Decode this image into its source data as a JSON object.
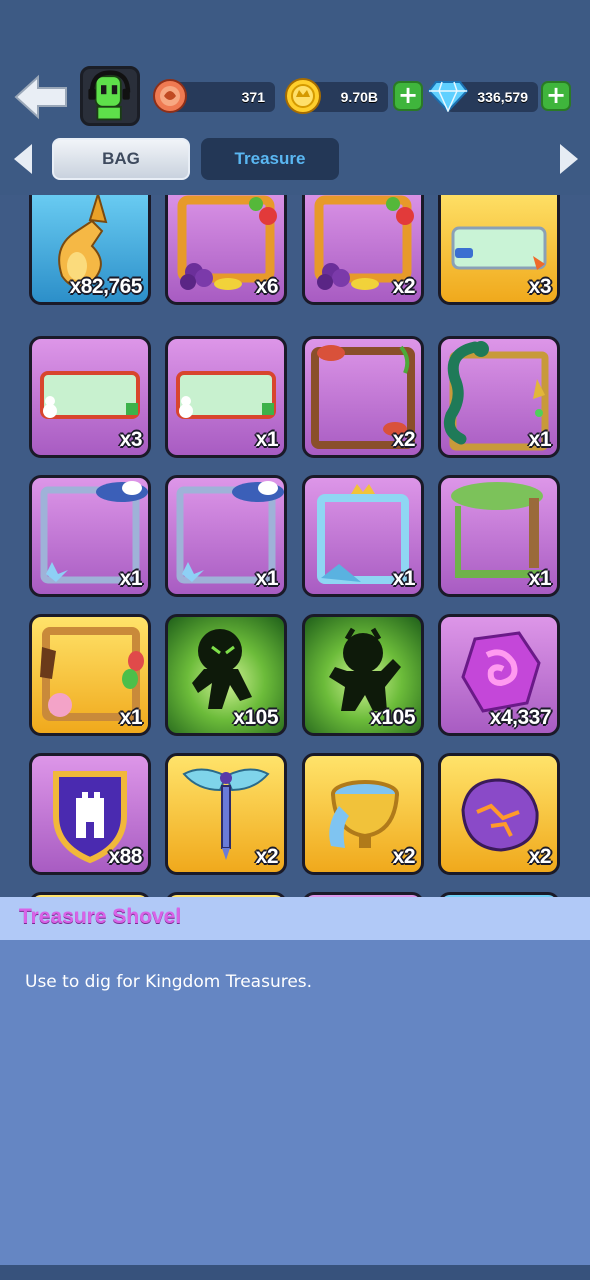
{
  "header": {
    "resources": [
      {
        "name": "energy-token",
        "value": "371"
      },
      {
        "name": "gold-coin",
        "value": "9.70B"
      },
      {
        "name": "diamond",
        "value": "336,579"
      }
    ]
  },
  "tabs": {
    "bag": "BAG",
    "treasure": "Treasure"
  },
  "items": [
    {
      "icon": "potion-bottle-icon",
      "bg": "blue",
      "qty": "x82,765"
    },
    {
      "icon": "fruit-frame-icon",
      "bg": "purple",
      "qty": "x6"
    },
    {
      "icon": "fruit-frame-icon",
      "bg": "purple",
      "qty": "x2"
    },
    {
      "icon": "vip-nameplate-icon",
      "bg": "gold",
      "qty": "x3"
    },
    {
      "icon": "snowman-nameplate-icon",
      "bg": "purple",
      "qty": "x3"
    },
    {
      "icon": "snowman-nameplate-icon",
      "bg": "purple",
      "qty": "x1"
    },
    {
      "icon": "mushroom-frame-icon",
      "bg": "purple",
      "qty": "x2"
    },
    {
      "icon": "serpent-frame-icon",
      "bg": "purple",
      "qty": "x1"
    },
    {
      "icon": "winter-hat-frame-icon",
      "bg": "purple",
      "qty": "x1"
    },
    {
      "icon": "winter-hat-frame-icon",
      "bg": "purple",
      "qty": "x1"
    },
    {
      "icon": "ice-crown-frame-icon",
      "bg": "purple",
      "qty": "x1"
    },
    {
      "icon": "tree-frame-icon",
      "bg": "purple",
      "qty": "x1"
    },
    {
      "icon": "party-frame-icon",
      "bg": "gold",
      "qty": "x1"
    },
    {
      "icon": "shadow-runner-icon",
      "bg": "green",
      "qty": "x105"
    },
    {
      "icon": "shadow-dancer-icon",
      "bg": "green",
      "qty": "x105"
    },
    {
      "icon": "purple-gem-icon",
      "bg": "purple",
      "qty": "x4,337"
    },
    {
      "icon": "castle-shield-icon",
      "bg": "purple",
      "qty": "x88"
    },
    {
      "icon": "winged-sword-icon",
      "bg": "gold",
      "qty": "x2"
    },
    {
      "icon": "paint-bowl-icon",
      "bg": "gold",
      "qty": "x2"
    },
    {
      "icon": "magma-rock-icon",
      "bg": "gold",
      "qty": "x2"
    }
  ],
  "description": {
    "title": "Treasure Shovel",
    "text": "Use to dig for Kingdom Treasures."
  },
  "colors": {
    "accent_title": "#d863e7",
    "plus_green": "#3fb53c",
    "treasure_tab": "#5ab7f2"
  }
}
